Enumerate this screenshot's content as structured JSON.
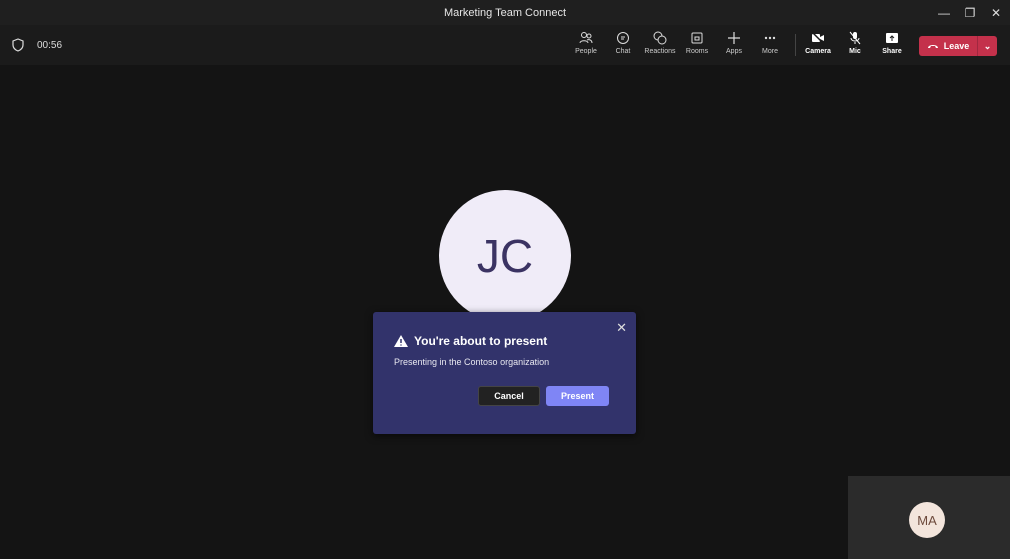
{
  "window": {
    "title": "Marketing Team Connect",
    "minimize": "—",
    "restore": "❐",
    "close": "✕"
  },
  "toolbar": {
    "timer": "00:56",
    "buttons": [
      {
        "label": "People",
        "icon": "people-icon"
      },
      {
        "label": "Chat",
        "icon": "chat-icon"
      },
      {
        "label": "Reactions",
        "icon": "reactions-icon"
      },
      {
        "label": "Rooms",
        "icon": "rooms-icon"
      },
      {
        "label": "Apps",
        "icon": "plus-icon"
      },
      {
        "label": "More",
        "icon": "more-icon"
      },
      {
        "label": "Camera",
        "icon": "camera-off-icon"
      },
      {
        "label": "Mic",
        "icon": "mic-off-icon"
      },
      {
        "label": "Share",
        "icon": "share-icon"
      }
    ],
    "leave_label": "Leave",
    "leave_color": "#c4314b"
  },
  "stage": {
    "participant_initials": "JC"
  },
  "dialog": {
    "title": "You're about to present",
    "body": "Presenting in the Contoso organization",
    "cancel_label": "Cancel",
    "present_label": "Present",
    "close": "✕"
  },
  "self_view": {
    "initials": "MA"
  }
}
